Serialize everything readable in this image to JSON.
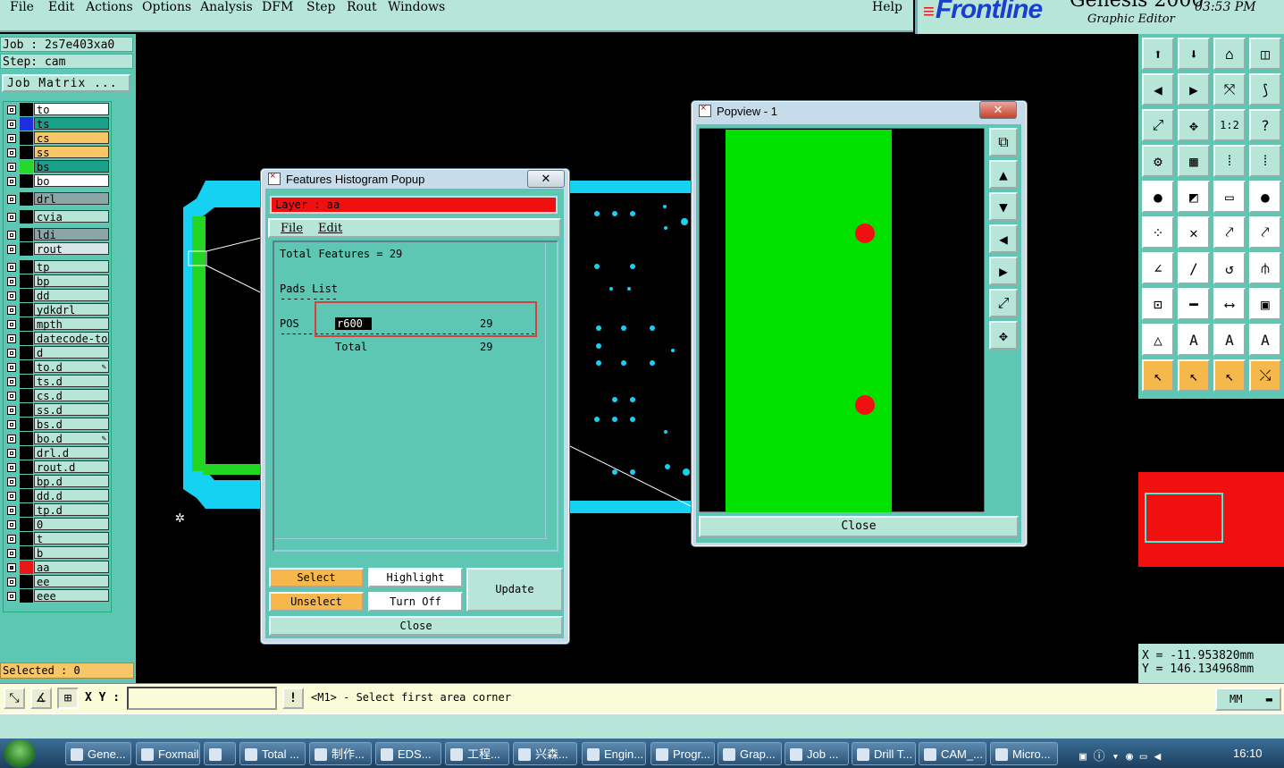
{
  "menubar": {
    "items": [
      "File",
      "Edit",
      "Actions",
      "Options",
      "Analysis",
      "DFM",
      "Step",
      "Rout",
      "Windows"
    ],
    "help": "Help"
  },
  "brand": {
    "logo": "Frontline",
    "product": "Genesis 2000",
    "subtitle": "Graphic Editor",
    "time": "03:53 PM"
  },
  "left": {
    "job": "Job : 2s7e403xa0",
    "step": "Step: cam",
    "job_matrix": "Job Matrix ...",
    "selected": "Selected : 0",
    "layers": [
      {
        "name": "to",
        "swatch": "#000000",
        "color": "#ffffff"
      },
      {
        "name": "ts",
        "swatch": "#1e2fe0",
        "color": "#1aa088"
      },
      {
        "name": "cs",
        "swatch": "#000000",
        "color": "#f6c667"
      },
      {
        "name": "ss",
        "swatch": "#000000",
        "color": "#f6c667"
      },
      {
        "name": "bs",
        "swatch": "#28d828",
        "color": "#1aa088"
      },
      {
        "name": "bo",
        "swatch": "#000000",
        "color": "#ffffff"
      },
      {
        "name": "drl",
        "swatch": "#000000",
        "color": "#8aa6a6"
      },
      {
        "name": "cvia",
        "swatch": "#000000",
        "color": "#b7e6d8"
      },
      {
        "name": "ldi",
        "swatch": "#000000",
        "color": "#8aa6a6"
      },
      {
        "name": "rout",
        "swatch": "#000000",
        "color": "#d8e6e6"
      },
      {
        "name": "tp",
        "swatch": "#000000",
        "color": "#b7e6d8"
      },
      {
        "name": "bp",
        "swatch": "#000000",
        "color": "#b7e6d8"
      },
      {
        "name": "dd",
        "swatch": "#000000",
        "color": "#b7e6d8"
      },
      {
        "name": "ydkdrl",
        "swatch": "#000000",
        "color": "#b7e6d8"
      },
      {
        "name": "mpth",
        "swatch": "#000000",
        "color": "#b7e6d8"
      },
      {
        "name": "datecode-to",
        "swatch": "#000000",
        "color": "#b7e6d8"
      },
      {
        "name": "d",
        "swatch": "#000000",
        "color": "#b7e6d8"
      },
      {
        "name": "to.d",
        "swatch": "#000000",
        "color": "#b7e6d8",
        "mark": true
      },
      {
        "name": "ts.d",
        "swatch": "#000000",
        "color": "#b7e6d8"
      },
      {
        "name": "cs.d",
        "swatch": "#000000",
        "color": "#b7e6d8"
      },
      {
        "name": "ss.d",
        "swatch": "#000000",
        "color": "#b7e6d8"
      },
      {
        "name": "bs.d",
        "swatch": "#000000",
        "color": "#b7e6d8"
      },
      {
        "name": "bo.d",
        "swatch": "#000000",
        "color": "#b7e6d8",
        "mark": true
      },
      {
        "name": "drl.d",
        "swatch": "#000000",
        "color": "#b7e6d8"
      },
      {
        "name": "rout.d",
        "swatch": "#000000",
        "color": "#b7e6d8"
      },
      {
        "name": "bp.d",
        "swatch": "#000000",
        "color": "#b7e6d8"
      },
      {
        "name": "dd.d",
        "swatch": "#000000",
        "color": "#b7e6d8"
      },
      {
        "name": "tp.d",
        "swatch": "#000000",
        "color": "#b7e6d8"
      },
      {
        "name": "0",
        "swatch": "#000000",
        "color": "#b7e6d8"
      },
      {
        "name": "t",
        "swatch": "#000000",
        "color": "#b7e6d8"
      },
      {
        "name": "b",
        "swatch": "#000000",
        "color": "#b7e6d8"
      },
      {
        "name": "aa",
        "swatch": "#e81818",
        "color": "#b7e6d8",
        "active": true
      },
      {
        "name": "ee",
        "swatch": "#000000",
        "color": "#b7e6d8"
      },
      {
        "name": "eee",
        "swatch": "#000000",
        "color": "#b7e6d8"
      }
    ]
  },
  "histogram": {
    "title": "Features Histogram Popup",
    "layer": "Layer :  aa",
    "menu": [
      "File",
      "Edit"
    ],
    "total_features": "Total Features = 29",
    "pads_list": "Pads List",
    "row_label": "POS",
    "row_symbol": "r600",
    "row_count": "29",
    "total_label": "Total",
    "total_count": "29",
    "buttons": {
      "select": "Select",
      "highlight": "Highlight",
      "update": "Update",
      "unselect": "Unselect",
      "turn_off": "Turn Off",
      "close": "Close"
    }
  },
  "popview": {
    "title": "Popview - 1",
    "close": "Close"
  },
  "coords": {
    "x": "X = -11.953820mm",
    "y": "Y = 146.134968mm"
  },
  "status": {
    "xy_label": "X Y :",
    "message": "<M1> - Select first area corner",
    "units": "MM"
  },
  "taskbar": {
    "items": [
      "Gene...",
      "Foxmail",
      "",
      "Total ...",
      "制作...",
      "EDS...",
      "工程...",
      "兴森...",
      "Engin...",
      "Progr...",
      "Grap...",
      "Job ...",
      "Drill T...",
      "CAM_...",
      "Micro..."
    ],
    "time": "16:10"
  }
}
